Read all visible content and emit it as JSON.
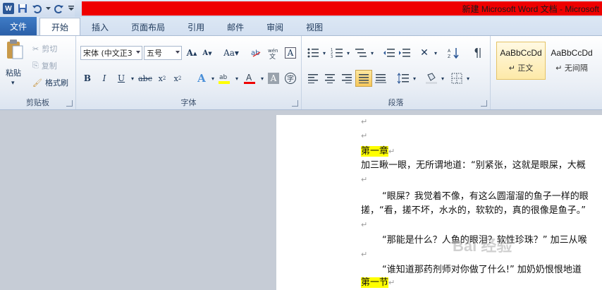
{
  "title": "新建 Microsoft Word 文档 - Microsoft",
  "quick_access": {
    "icons": [
      "word-logo",
      "save-icon",
      "undo-icon",
      "redo-icon",
      "customize-icon"
    ]
  },
  "tabs": [
    "文件",
    "开始",
    "插入",
    "页面布局",
    "引用",
    "邮件",
    "审阅",
    "视图"
  ],
  "clipboard": {
    "paste": "粘贴",
    "cut": "剪切",
    "copy": "复制",
    "format_painter": "格式刷",
    "label": "剪贴板"
  },
  "font": {
    "name": "宋体 (中文正3",
    "size": "五号",
    "label": "字体"
  },
  "paragraph": {
    "label": "段落"
  },
  "styles": {
    "items": [
      {
        "preview": "AaBbCcDd",
        "name": "↵ 正文"
      },
      {
        "preview": "AaBbCcDd",
        "name": "↵ 无间隔"
      }
    ]
  },
  "document": {
    "heading1": "第一章",
    "line1": "加三瞅一眼，无所谓地道：“别紧张，这就是眼屎，大概",
    "para2a": "“眼屎？我觉着不像，有这么圆溜溜的鱼子一样的眼",
    "para2b": "搓，“看，搓不坏，水水的，软软的，真的很像是鱼子。”",
    "para3": "“那能是什么？人鱼的眼泪？软性珍珠？” 加三从喉",
    "para4": "“谁知道那药剂师对你做了什么!” 加奶奶恨恨地道",
    "heading2": "第一节",
    "watermark": "Bai 经验"
  },
  "colors": {
    "title_bar": "#ef0000",
    "file_tab": "#2a5fa8",
    "highlight": "#ffff00"
  }
}
